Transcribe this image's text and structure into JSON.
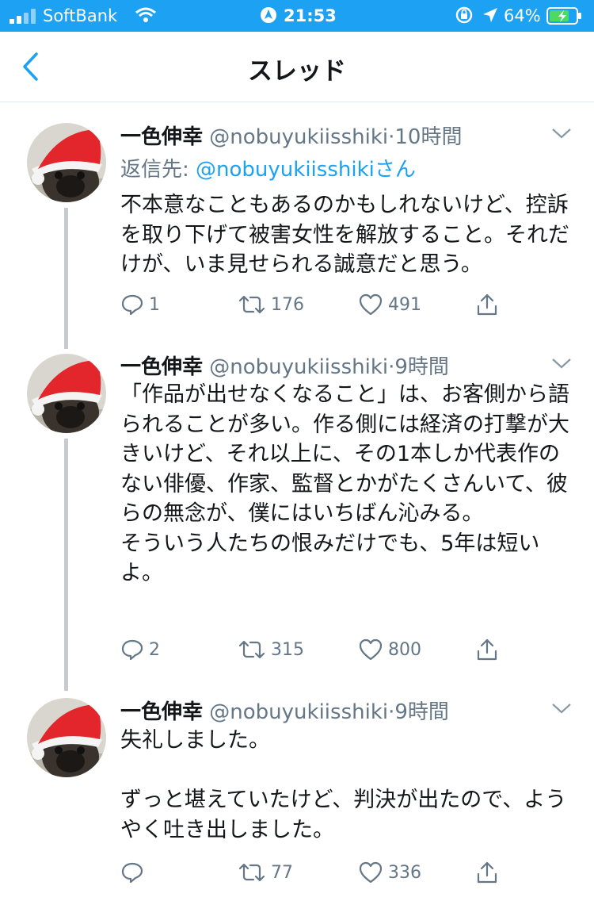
{
  "status_bar": {
    "carrier": "SoftBank",
    "time": "21:53",
    "battery": "64%"
  },
  "header": {
    "title": "スレッド"
  },
  "colors": {
    "accent": "#1da1f2",
    "text": "#14171a",
    "secondary": "#657786"
  },
  "tweets": [
    {
      "name": "一色伸幸",
      "handle": "@nobuyukiisshiki",
      "sep": "·",
      "time": "10時間",
      "reply_prefix": "返信先: ",
      "reply_to": "@nobuyukiisshikiさん",
      "text": "不本意なこともあるのかもしれないけど、控訴を取り下げて被害女性を解放すること。それだけが、いま見せられる誠意だと思う。",
      "replies": "1",
      "retweets": "176",
      "likes": "491"
    },
    {
      "name": "一色伸幸",
      "handle": "@nobuyukiisshiki",
      "sep": "·",
      "time": "9時間",
      "text": "「作品が出せなくなること」は、お客側から語られることが多い。作る側には経済の打撃が大きいけど、それ以上に、その1本しか代表作のない俳優、作家、監督とかがたくさんいて、彼らの無念が、僕にはいちばん沁みる。\nそういう人たちの恨みだけでも、5年は短いよ。",
      "replies": "2",
      "retweets": "315",
      "likes": "800"
    },
    {
      "name": "一色伸幸",
      "handle": "@nobuyukiisshiki",
      "sep": "·",
      "time": "9時間",
      "text": "失礼しました。\n\nずっと堪えていたけど、判決が出たので、ようやく吐き出しました。",
      "replies": "",
      "retweets": "77",
      "likes": "336"
    }
  ]
}
